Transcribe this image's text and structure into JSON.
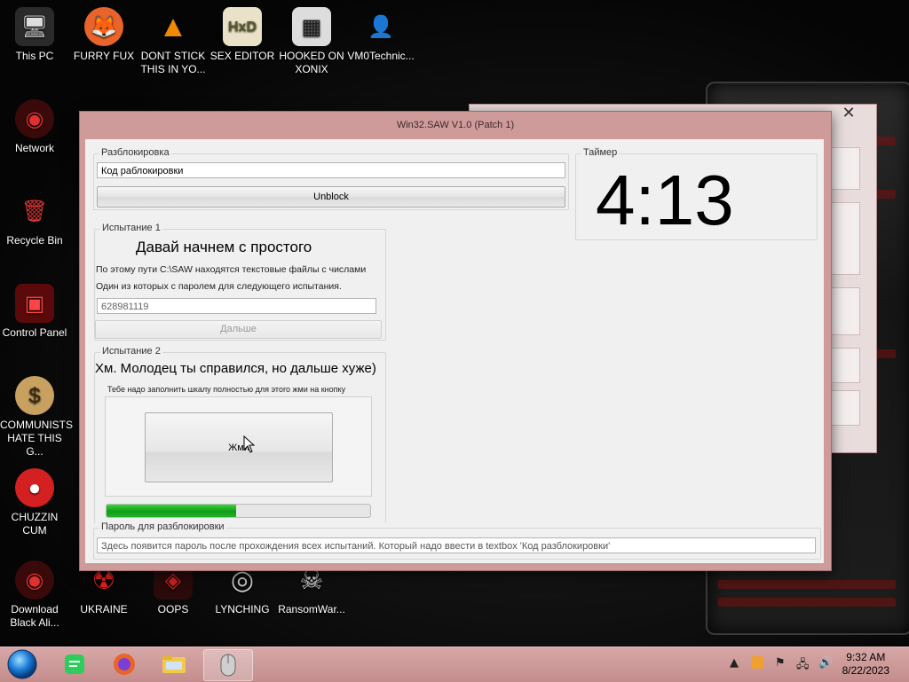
{
  "desktop": {
    "icons": [
      {
        "label": "This PC",
        "glyph": "🖥"
      },
      {
        "label": "FURRY FUX",
        "glyph": "🦊"
      },
      {
        "label": "DONT STICK THIS IN YO...",
        "glyph": "▲"
      },
      {
        "label": "SEX EDITOR",
        "glyph": "HxD"
      },
      {
        "label": "HOOKED ON XONIX",
        "glyph": "▦"
      },
      {
        "label": "VM0Technic...",
        "glyph": "👤"
      },
      {
        "label": "Network",
        "glyph": "◉"
      },
      {
        "label": "Recycle Bin",
        "glyph": "🗑"
      },
      {
        "label": "Control Panel",
        "glyph": "▣"
      },
      {
        "label": "COMMUNISTS HATE THIS G...",
        "glyph": "$"
      },
      {
        "label": "CHUZZIN CUM",
        "glyph": "●"
      },
      {
        "label": "Download Black Ali...",
        "glyph": "◉"
      },
      {
        "label": "UKRAINE",
        "glyph": "☢"
      },
      {
        "label": "OOPS",
        "glyph": "◈"
      },
      {
        "label": "LYNCHING",
        "glyph": "◎"
      },
      {
        "label": "RansomWar...",
        "glyph": "☠"
      }
    ]
  },
  "window": {
    "title": "Win32.SAW V1.0 (Patch 1)",
    "unlock": {
      "legend": "Разблокировка",
      "code_value": "Код раблокировки",
      "button": "Unblock"
    },
    "timer": {
      "legend": "Таймер",
      "value": "4:13"
    },
    "test1": {
      "legend": "Испытание 1",
      "heading": "Давай начнем с простого",
      "line1": "По этому пути C:\\SAW находятся текстовые файлы с числами",
      "line2": "Один из которых с паролем для следующего испытания.",
      "input_value": "628981119",
      "button": "Дальше"
    },
    "test2": {
      "legend": "Испытание 2",
      "heading": "Хм. Молодец ты справился, но дальше хуже)",
      "hint": "Тебе надо заполнить шкалу полностью для этого жми на кнопку",
      "button": "Жми",
      "progress": 0.49
    },
    "password": {
      "legend": "Пароль для разблокировки",
      "value": "Здесь появится пароль после прохождения всех испытаний. Который надо ввести в textbox 'Код разблокировки'"
    }
  },
  "taskbar": {
    "time": "9:32 AM",
    "date": "8/22/2023"
  },
  "colors": {
    "window_frame": "#cf9a9a",
    "taskbar": "#c48d8d",
    "progress_green": "#1fb327"
  }
}
